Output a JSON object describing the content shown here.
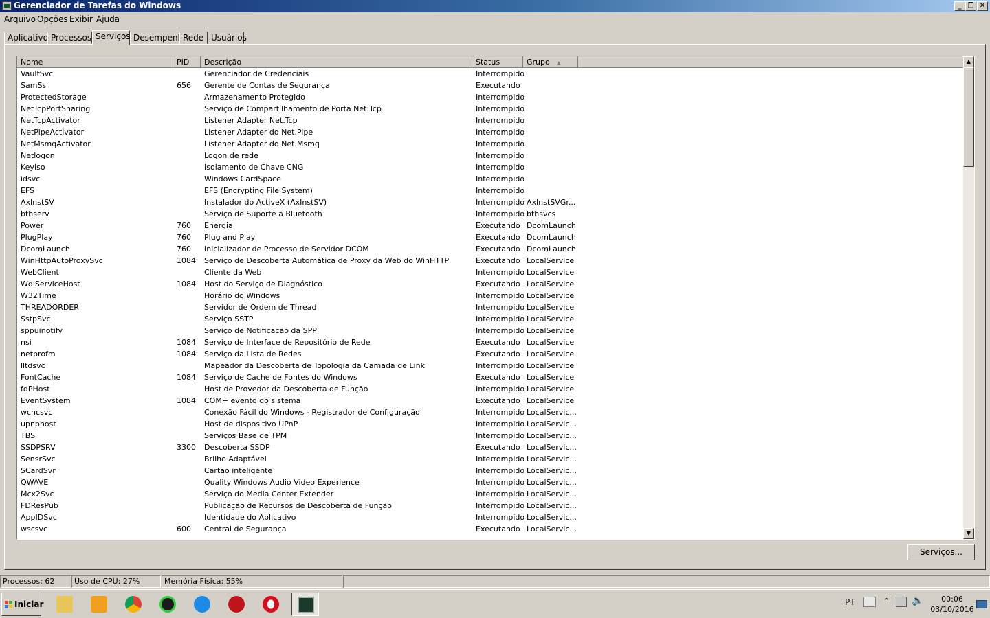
{
  "window": {
    "title": "Gerenciador de Tarefas do Windows"
  },
  "menu": [
    "Arquivo",
    "Opções",
    "Exibir",
    "Ajuda"
  ],
  "tabs": [
    {
      "label": "Aplicativos",
      "active": false
    },
    {
      "label": "Processos",
      "active": false
    },
    {
      "label": "Serviços",
      "active": true
    },
    {
      "label": "Desempenho",
      "active": false
    },
    {
      "label": "Rede",
      "active": false
    },
    {
      "label": "Usuários",
      "active": false
    }
  ],
  "columns": {
    "nome": "Nome",
    "pid": "PID",
    "desc": "Descrição",
    "status": "Status",
    "grupo": "Grupo"
  },
  "services": [
    [
      "VaultSvc",
      "",
      "Gerenciador de Credenciais",
      "Interrompido",
      ""
    ],
    [
      "SamSs",
      "656",
      "Gerente de Contas de Segurança",
      "Executando",
      ""
    ],
    [
      "ProtectedStorage",
      "",
      "Armazenamento Protegido",
      "Interrompido",
      ""
    ],
    [
      "NetTcpPortSharing",
      "",
      "Serviço de Compartilhamento de Porta Net.Tcp",
      "Interrompido",
      ""
    ],
    [
      "NetTcpActivator",
      "",
      "Listener Adapter Net.Tcp",
      "Interrompido",
      ""
    ],
    [
      "NetPipeActivator",
      "",
      "Listener Adapter do Net.Pipe",
      "Interrompido",
      ""
    ],
    [
      "NetMsmqActivator",
      "",
      "Listener Adapter do Net.Msmq",
      "Interrompido",
      ""
    ],
    [
      "Netlogon",
      "",
      "Logon de rede",
      "Interrompido",
      ""
    ],
    [
      "KeyIso",
      "",
      "Isolamento de Chave CNG",
      "Interrompido",
      ""
    ],
    [
      "idsvc",
      "",
      "Windows CardSpace",
      "Interrompido",
      ""
    ],
    [
      "EFS",
      "",
      "EFS (Encrypting File System)",
      "Interrompido",
      ""
    ],
    [
      "AxInstSV",
      "",
      "Instalador do ActiveX (AxInstSV)",
      "Interrompido",
      "AxInstSVGr..."
    ],
    [
      "bthserv",
      "",
      "Serviço de Suporte a Bluetooth",
      "Interrompido",
      "bthsvcs"
    ],
    [
      "Power",
      "760",
      "Energia",
      "Executando",
      "DcomLaunch"
    ],
    [
      "PlugPlay",
      "760",
      "Plug and Play",
      "Executando",
      "DcomLaunch"
    ],
    [
      "DcomLaunch",
      "760",
      "Inicializador de Processo de Servidor DCOM",
      "Executando",
      "DcomLaunch"
    ],
    [
      "WinHttpAutoProxySvc",
      "1084",
      "Serviço de Descoberta Automática de Proxy da Web do WinHTTP",
      "Executando",
      "LocalService"
    ],
    [
      "WebClient",
      "",
      "Cliente da Web",
      "Interrompido",
      "LocalService"
    ],
    [
      "WdiServiceHost",
      "1084",
      "Host do Serviço de Diagnóstico",
      "Executando",
      "LocalService"
    ],
    [
      "W32Time",
      "",
      "Horário do Windows",
      "Interrompido",
      "LocalService"
    ],
    [
      "THREADORDER",
      "",
      "Servidor de Ordem de Thread",
      "Interrompido",
      "LocalService"
    ],
    [
      "SstpSvc",
      "",
      "Serviço SSTP",
      "Interrompido",
      "LocalService"
    ],
    [
      "sppuinotify",
      "",
      "Serviço de Notificação da SPP",
      "Interrompido",
      "LocalService"
    ],
    [
      "nsi",
      "1084",
      "Serviço de Interface de Repositório de Rede",
      "Executando",
      "LocalService"
    ],
    [
      "netprofm",
      "1084",
      "Serviço da Lista de Redes",
      "Executando",
      "LocalService"
    ],
    [
      "lltdsvc",
      "",
      "Mapeador da Descoberta de Topologia da Camada de Link",
      "Interrompido",
      "LocalService"
    ],
    [
      "FontCache",
      "1084",
      "Serviço de Cache de Fontes do Windows",
      "Executando",
      "LocalService"
    ],
    [
      "fdPHost",
      "",
      "Host de Provedor da Descoberta de Função",
      "Interrompido",
      "LocalService"
    ],
    [
      "EventSystem",
      "1084",
      "COM+ evento do sistema",
      "Executando",
      "LocalService"
    ],
    [
      "wcncsvc",
      "",
      "Conexão Fácil do Windows - Registrador de Configuração",
      "Interrompido",
      "LocalServic..."
    ],
    [
      "upnphost",
      "",
      "Host de dispositivo UPnP",
      "Interrompido",
      "LocalServic..."
    ],
    [
      "TBS",
      "",
      "Serviços Base de TPM",
      "Interrompido",
      "LocalServic..."
    ],
    [
      "SSDPSRV",
      "3300",
      "Descoberta SSDP",
      "Executando",
      "LocalServic..."
    ],
    [
      "SensrSvc",
      "",
      "Brilho Adaptável",
      "Interrompido",
      "LocalServic..."
    ],
    [
      "SCardSvr",
      "",
      "Cartão inteligente",
      "Interrompido",
      "LocalServic..."
    ],
    [
      "QWAVE",
      "",
      "Quality Windows Audio Video Experience",
      "Interrompido",
      "LocalServic..."
    ],
    [
      "Mcx2Svc",
      "",
      "Serviço do Media Center Extender",
      "Interrompido",
      "LocalServic..."
    ],
    [
      "FDResPub",
      "",
      "Publicação de Recursos de Descoberta de Função",
      "Interrompido",
      "LocalServic..."
    ],
    [
      "AppIDSvc",
      "",
      "Identidade do Aplicativo",
      "Interrompido",
      "LocalServic..."
    ],
    [
      "wscsvc",
      "600",
      "Central de Segurança",
      "Executando",
      "LocalServic..."
    ]
  ],
  "services_button": "Serviços...",
  "statusbar": {
    "processes": "Processos: 62",
    "cpu": "Uso de CPU: 27%",
    "memory": "Memória Física: 55%"
  },
  "taskbar": {
    "start_label": "Iniciar",
    "apps": [
      "file-explorer-icon",
      "media-player-icon",
      "chrome-icon",
      "green-app-icon",
      "blue-app-icon",
      "red-app-icon",
      "opera-icon",
      "task-manager-icon"
    ],
    "language": "PT",
    "time": "00:06",
    "date": "03/10/2016"
  },
  "colors": {
    "title_start": "#0a246a",
    "title_end": "#a6caf0",
    "chrome": "#d4d0c8"
  }
}
